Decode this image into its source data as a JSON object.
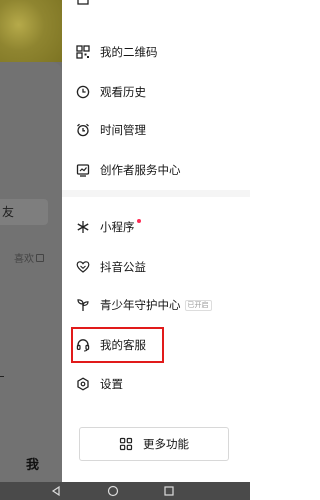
{
  "left": {
    "friend_label": "友",
    "likes_label": "喜欢",
    "tab_me": "我"
  },
  "drawer": {
    "items": [
      {
        "label": "我的二维码",
        "icon": "qr-code-icon"
      },
      {
        "label": "观看历史",
        "icon": "clock-icon"
      },
      {
        "label": "时间管理",
        "icon": "alarm-clock-icon"
      },
      {
        "label": "创作者服务中心",
        "icon": "chart-icon"
      },
      {
        "label": "小程序",
        "icon": "asterisk-icon"
      },
      {
        "label": "抖音公益",
        "icon": "heart-hands-icon"
      },
      {
        "label": "青少年守护中心",
        "icon": "sprout-icon",
        "badge": "已开启"
      },
      {
        "label": "我的客服",
        "icon": "headset-icon"
      },
      {
        "label": "设置",
        "icon": "settings-icon"
      }
    ],
    "more_label": "更多功能"
  },
  "colors": {
    "highlight": "#e11a1a",
    "dot": "#fe2c55"
  }
}
